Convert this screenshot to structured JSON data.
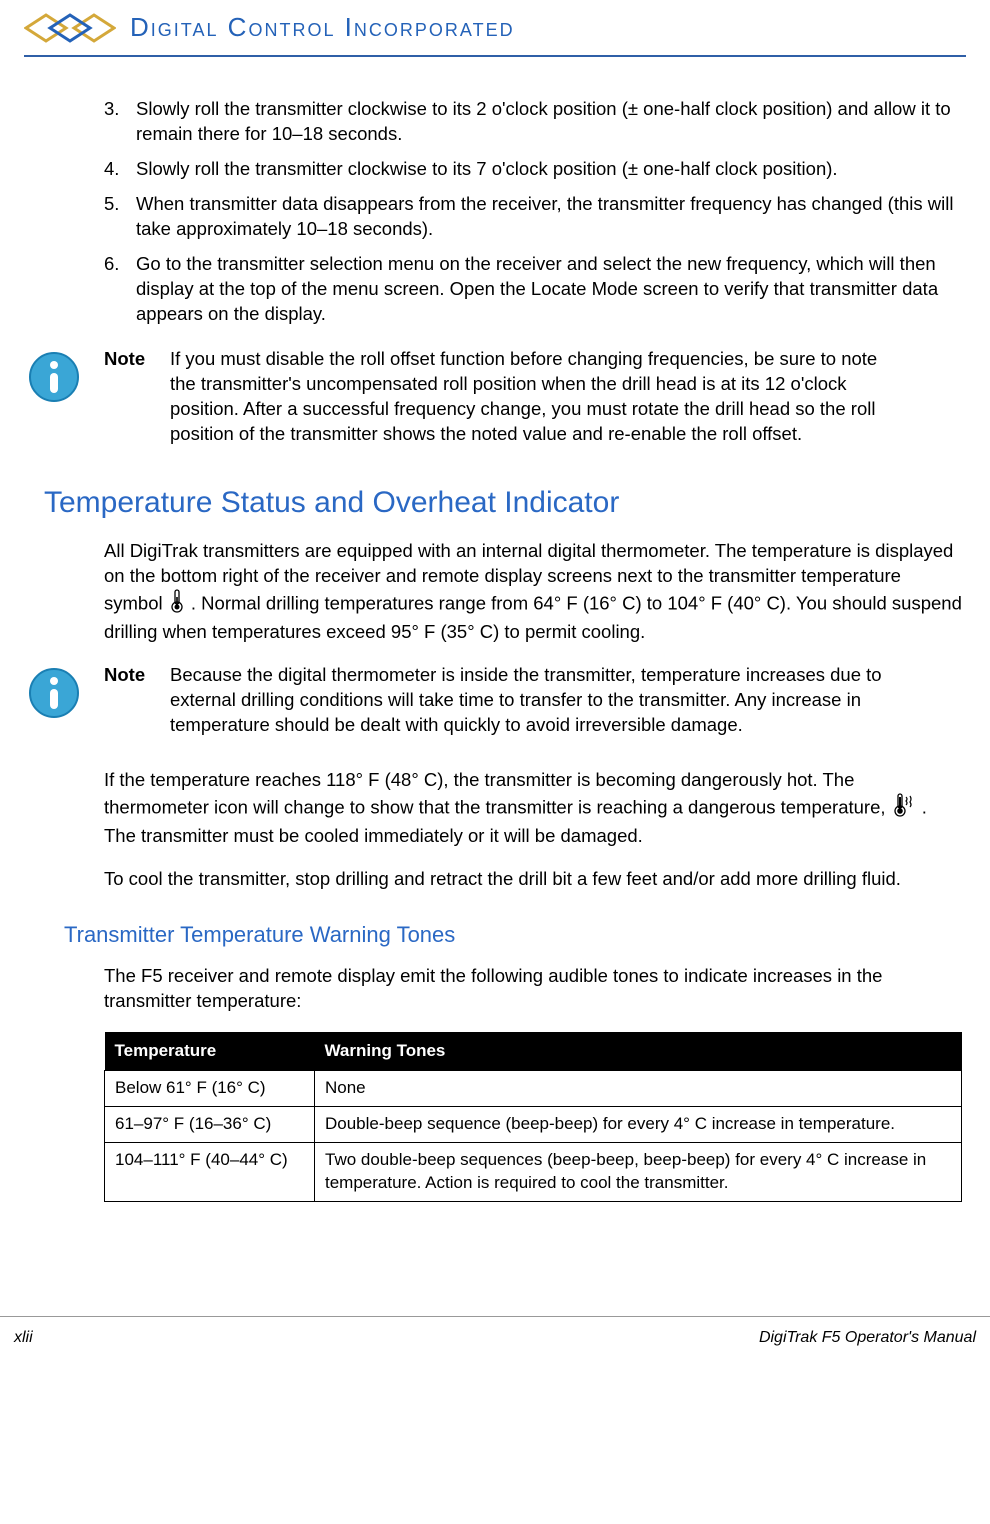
{
  "header": {
    "company": "Digital Control Incorporated"
  },
  "steps": [
    {
      "n": "3.",
      "t": "Slowly roll the transmitter clockwise to its 2 o'clock position (± one-half clock position) and allow it to remain there for 10–18 seconds."
    },
    {
      "n": "4.",
      "t": "Slowly roll the transmitter clockwise to its 7 o'clock position (± one-half clock position)."
    },
    {
      "n": "5.",
      "t": "When transmitter data disappears from the receiver, the transmitter frequency has changed (this will take approximately 10–18 seconds)."
    },
    {
      "n": "6.",
      "t": "Go to the transmitter selection menu on the receiver and select the new frequency, which will then display at the top of the menu screen. Open the Locate Mode screen to verify that transmitter data appears on the display."
    }
  ],
  "note1": {
    "label": "Note",
    "text": "If you must disable the roll offset function before changing frequencies, be sure to note the transmitter's uncompensated roll position when the drill head is at its 12 o'clock position. After a successful frequency change, you must rotate the drill head so the roll position of the transmitter shows the noted value and re-enable the roll offset."
  },
  "section1": {
    "title": "Temperature Status and Overheat Indicator",
    "p1a": "All DigiTrak transmitters are equipped with an internal digital thermometer. The temperature is displayed on the bottom right of the receiver and remote display screens next to the transmitter temperature symbol ",
    "p1b": ". Normal drilling temperatures range from 64° F (16° C) to 104° F (40° C). You should suspend drilling when temperatures exceed 95° F (35° C) to permit cooling."
  },
  "note2": {
    "label": "Note",
    "text": "Because the digital thermometer is inside the transmitter, temperature increases due to external drilling conditions will take time to transfer to the transmitter. Any increase in temperature should be dealt with quickly to avoid irreversible damage."
  },
  "p2a": "If the temperature reaches 118° F (48° C), the transmitter is becoming dangerously hot. The thermometer icon will change to show that the transmitter is reaching a dangerous temperature, ",
  "p2b": ". The transmitter must be cooled immediately or it will be damaged.",
  "p3": "To cool the transmitter, stop drilling and retract the drill bit a few feet and/or add more drilling fluid.",
  "subsection": "Transmitter Temperature Warning Tones",
  "p4": "The F5 receiver and remote display emit the following audible tones to indicate increases in the transmitter temperature:",
  "table": {
    "h1": "Temperature",
    "h2": "Warning Tones",
    "rows": [
      {
        "c1": "Below 61° F (16° C)",
        "c2": "None"
      },
      {
        "c1": "61–97° F (16–36° C)",
        "c2": "Double-beep sequence (beep-beep) for every 4° C increase in temperature."
      },
      {
        "c1": "104–111° F (40–44° C)",
        "c2": "Two double-beep sequences (beep-beep, beep-beep) for every 4° C increase in temperature. Action is required to cool the transmitter."
      }
    ]
  },
  "footer": {
    "left": "xlii",
    "right": "DigiTrak F5 Operator's Manual"
  }
}
